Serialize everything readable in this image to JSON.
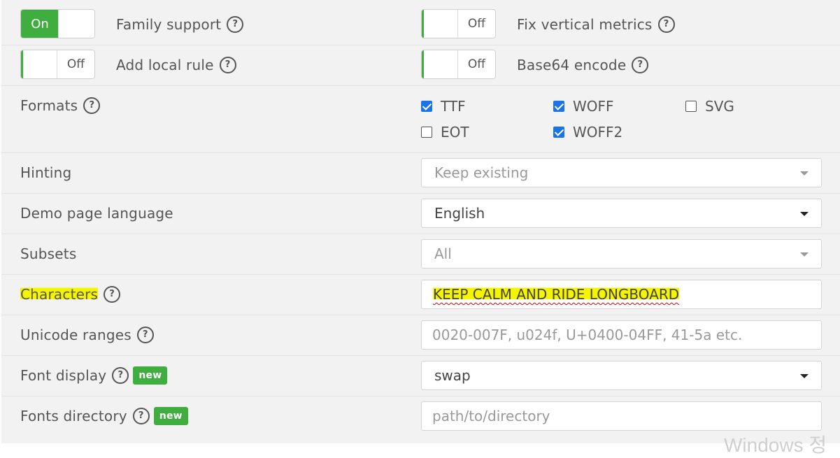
{
  "toggles": {
    "family_support": {
      "state": "On",
      "label": "Family support"
    },
    "fix_vertical_metrics": {
      "state": "Off",
      "label": "Fix vertical metrics"
    },
    "add_local_rule": {
      "state": "Off",
      "label": "Add local rule"
    },
    "base64_encode": {
      "state": "Off",
      "label": "Base64 encode"
    }
  },
  "formats": {
    "label": "Formats",
    "options": [
      {
        "name": "TTF",
        "checked": true
      },
      {
        "name": "WOFF",
        "checked": true
      },
      {
        "name": "SVG",
        "checked": false
      },
      {
        "name": "EOT",
        "checked": false
      },
      {
        "name": "WOFF2",
        "checked": true
      }
    ]
  },
  "hinting": {
    "label": "Hinting",
    "value": "Keep existing"
  },
  "demo_language": {
    "label": "Demo page language",
    "value": "English"
  },
  "subsets": {
    "label": "Subsets",
    "value": "All"
  },
  "characters": {
    "label": "Characters",
    "value": "KEEP CALM AND RIDE LONGBOARD"
  },
  "unicode_ranges": {
    "label": "Unicode ranges",
    "placeholder": "0020-007F, u024f, U+0400-04FF, 41-5a etc."
  },
  "font_display": {
    "label": "Font display",
    "badge": "new",
    "value": "swap"
  },
  "fonts_directory": {
    "label": "Fonts directory",
    "badge": "new",
    "placeholder": "path/to/directory"
  },
  "help_glyph": "?",
  "watermark": "Windows 정",
  "colors": {
    "accent_green": "#3fae3f",
    "checkbox_blue": "#1a73e8",
    "highlight": "#f5f500"
  }
}
